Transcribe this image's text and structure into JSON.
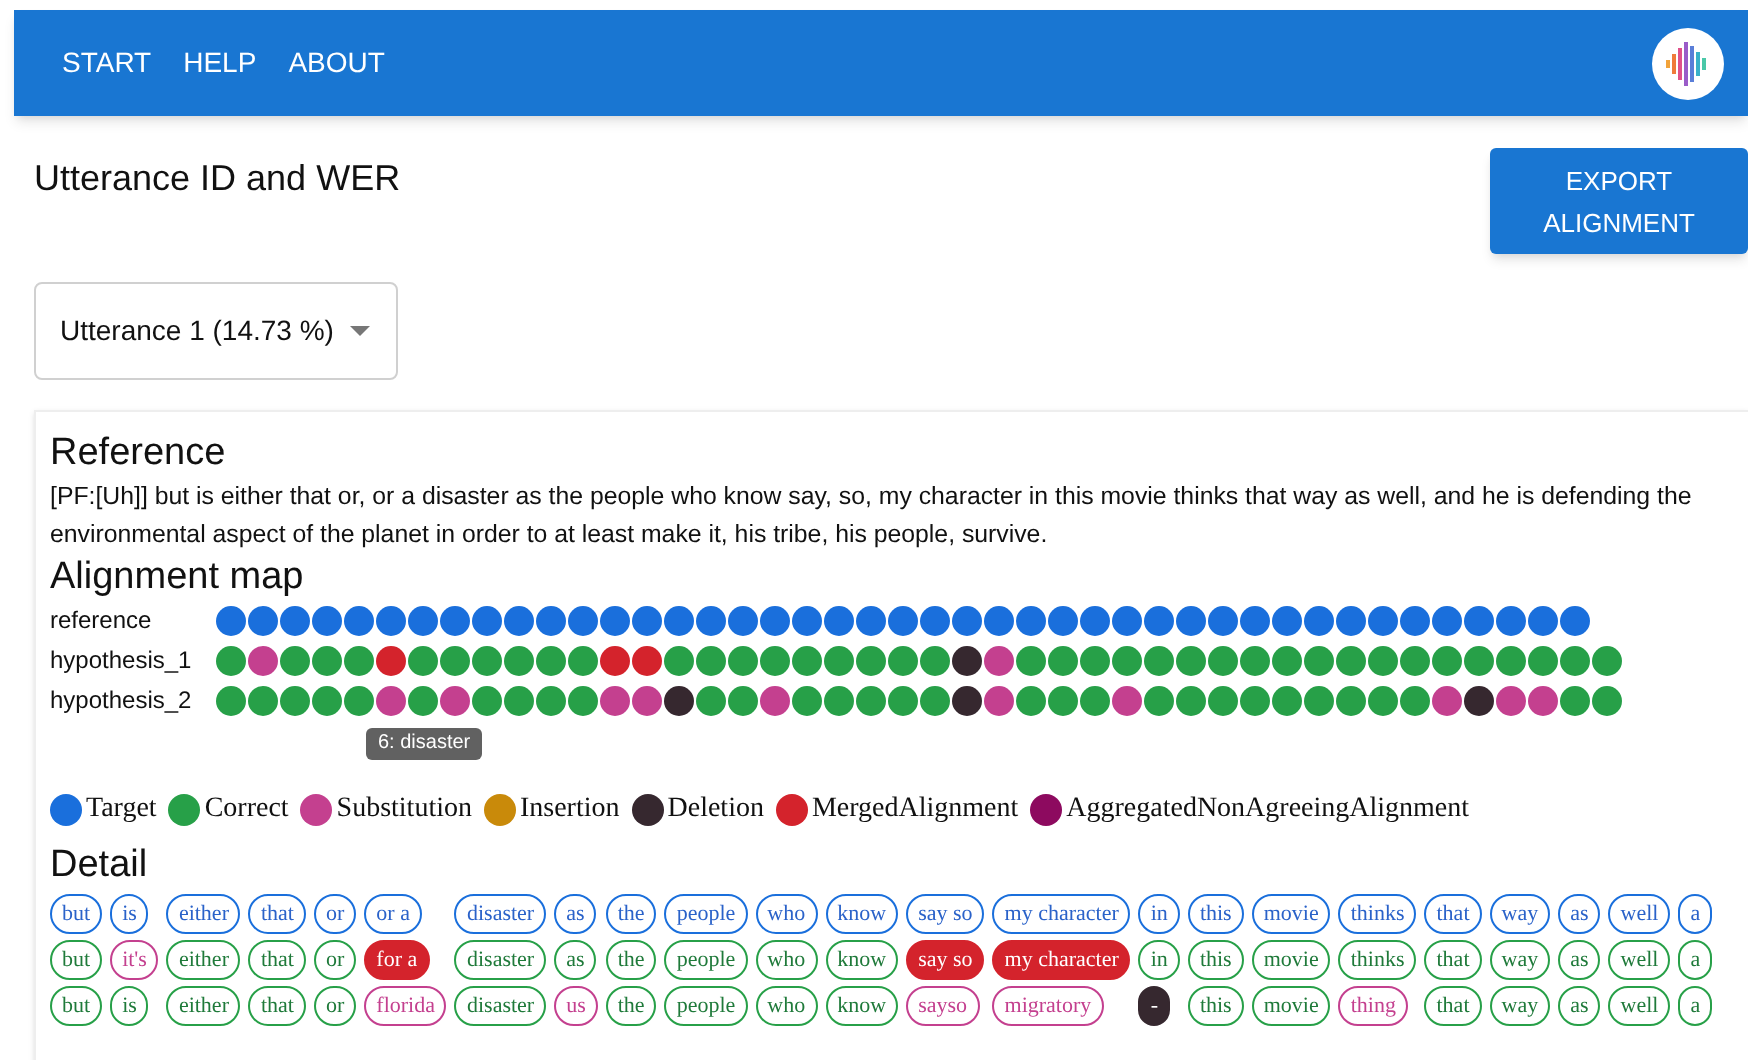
{
  "nav": {
    "items": [
      "START",
      "HELP",
      "ABOUT"
    ]
  },
  "heading": "Utterance ID and WER",
  "export_button": "EXPORT ALIGNMENT",
  "utterance_select": {
    "value": "Utterance 1 (14.73 %)"
  },
  "reference": {
    "title": "Reference",
    "text": "[PF:[Uh]] but is either that or, or a disaster as the people who know say, so, my character in this movie thinks that way as well, and he is defending the environmental aspect of the planet in order to at least make it, his tribe, his people, survive."
  },
  "alignment_map": {
    "title": "Alignment map",
    "rows": [
      {
        "label": "reference",
        "dots": [
          {
            "kind": "target"
          },
          {
            "kind": "target"
          },
          {
            "kind": "target"
          },
          {
            "kind": "target"
          },
          {
            "kind": "target"
          },
          {
            "kind": "target"
          },
          {
            "kind": "target"
          },
          {
            "kind": "target"
          },
          {
            "kind": "target"
          },
          {
            "kind": "target"
          },
          {
            "kind": "target"
          },
          {
            "kind": "target"
          },
          {
            "kind": "target"
          },
          {
            "kind": "target"
          },
          {
            "kind": "target"
          },
          {
            "kind": "target"
          },
          {
            "kind": "target"
          },
          {
            "kind": "target"
          },
          {
            "kind": "target"
          },
          {
            "kind": "target"
          },
          {
            "kind": "target"
          },
          {
            "kind": "target"
          },
          {
            "kind": "target"
          },
          {
            "kind": "target"
          },
          {
            "kind": "target"
          },
          {
            "kind": "target"
          },
          {
            "kind": "target"
          },
          {
            "kind": "target"
          },
          {
            "kind": "target"
          },
          {
            "kind": "target"
          },
          {
            "kind": "target"
          },
          {
            "kind": "target"
          },
          {
            "kind": "target"
          },
          {
            "kind": "target"
          },
          {
            "kind": "target"
          },
          {
            "kind": "target"
          },
          {
            "kind": "target"
          },
          {
            "kind": "target"
          },
          {
            "kind": "target"
          },
          {
            "kind": "target"
          },
          {
            "kind": "target"
          },
          {
            "kind": "target"
          },
          {
            "kind": "target"
          }
        ]
      },
      {
        "label": "hypothesis_1",
        "dots": [
          {
            "kind": "correct"
          },
          {
            "kind": "substitution"
          },
          {
            "kind": "correct"
          },
          {
            "kind": "correct"
          },
          {
            "kind": "correct"
          },
          {
            "kind": "merged"
          },
          {
            "kind": "correct"
          },
          {
            "kind": "correct"
          },
          {
            "kind": "correct"
          },
          {
            "kind": "correct"
          },
          {
            "kind": "correct"
          },
          {
            "kind": "correct"
          },
          {
            "kind": "merged"
          },
          {
            "kind": "merged"
          },
          {
            "kind": "correct"
          },
          {
            "kind": "correct"
          },
          {
            "kind": "correct"
          },
          {
            "kind": "correct"
          },
          {
            "kind": "correct"
          },
          {
            "kind": "correct"
          },
          {
            "kind": "correct"
          },
          {
            "kind": "correct"
          },
          {
            "kind": "correct"
          },
          {
            "kind": "deletion"
          },
          {
            "kind": "substitution"
          },
          {
            "kind": "correct"
          },
          {
            "kind": "correct"
          },
          {
            "kind": "correct"
          },
          {
            "kind": "correct"
          },
          {
            "kind": "correct"
          },
          {
            "kind": "correct"
          },
          {
            "kind": "correct"
          },
          {
            "kind": "correct"
          },
          {
            "kind": "correct"
          },
          {
            "kind": "correct"
          },
          {
            "kind": "correct"
          },
          {
            "kind": "correct"
          },
          {
            "kind": "correct"
          },
          {
            "kind": "correct"
          },
          {
            "kind": "correct"
          },
          {
            "kind": "correct"
          },
          {
            "kind": "correct"
          },
          {
            "kind": "correct"
          },
          {
            "kind": "correct"
          }
        ]
      },
      {
        "label": "hypothesis_2",
        "dots": [
          {
            "kind": "correct"
          },
          {
            "kind": "correct"
          },
          {
            "kind": "correct"
          },
          {
            "kind": "correct"
          },
          {
            "kind": "correct"
          },
          {
            "kind": "substitution"
          },
          {
            "kind": "correct",
            "tooltip": "6: disaster"
          },
          {
            "kind": "substitution"
          },
          {
            "kind": "correct"
          },
          {
            "kind": "correct"
          },
          {
            "kind": "correct"
          },
          {
            "kind": "correct"
          },
          {
            "kind": "substitution"
          },
          {
            "kind": "substitution"
          },
          {
            "kind": "deletion"
          },
          {
            "kind": "correct"
          },
          {
            "kind": "correct"
          },
          {
            "kind": "substitution"
          },
          {
            "kind": "correct"
          },
          {
            "kind": "correct"
          },
          {
            "kind": "correct"
          },
          {
            "kind": "correct"
          },
          {
            "kind": "correct"
          },
          {
            "kind": "deletion"
          },
          {
            "kind": "substitution"
          },
          {
            "kind": "correct"
          },
          {
            "kind": "correct"
          },
          {
            "kind": "correct"
          },
          {
            "kind": "substitution"
          },
          {
            "kind": "correct"
          },
          {
            "kind": "correct"
          },
          {
            "kind": "correct"
          },
          {
            "kind": "correct"
          },
          {
            "kind": "correct"
          },
          {
            "kind": "correct"
          },
          {
            "kind": "correct"
          },
          {
            "kind": "correct"
          },
          {
            "kind": "correct"
          },
          {
            "kind": "substitution"
          },
          {
            "kind": "deletion"
          },
          {
            "kind": "substitution"
          },
          {
            "kind": "substitution"
          },
          {
            "kind": "correct"
          },
          {
            "kind": "correct"
          }
        ]
      }
    ]
  },
  "legend": [
    {
      "label": "Target",
      "color": "#1a6fdc"
    },
    {
      "label": "Correct",
      "color": "#27a048"
    },
    {
      "label": "Substitution",
      "color": "#c4408f"
    },
    {
      "label": "Insertion",
      "color": "#c98a0a"
    },
    {
      "label": "Deletion",
      "color": "#36282f"
    },
    {
      "label": "MergedAlignment",
      "color": "#d4232c"
    },
    {
      "label": "AggregatedNonAgreeingAlignment",
      "color": "#8d0a5f"
    }
  ],
  "detail": {
    "title": "Detail",
    "columns": [
      [
        {
          "text": "but",
          "kind": "target"
        },
        {
          "text": "but",
          "kind": "correct"
        },
        {
          "text": "but",
          "kind": "correct"
        }
      ],
      [
        {
          "text": "is",
          "kind": "target"
        },
        {
          "text": "it's",
          "kind": "substitution"
        },
        {
          "text": "is",
          "kind": "correct"
        }
      ],
      [
        {
          "text": "either",
          "kind": "target"
        },
        {
          "text": "either",
          "kind": "correct"
        },
        {
          "text": "either",
          "kind": "correct"
        }
      ],
      [
        {
          "text": "that",
          "kind": "target"
        },
        {
          "text": "that",
          "kind": "correct"
        },
        {
          "text": "that",
          "kind": "correct"
        }
      ],
      [
        {
          "text": "or",
          "kind": "target"
        },
        {
          "text": "or",
          "kind": "correct"
        },
        {
          "text": "or",
          "kind": "correct"
        }
      ],
      [
        {
          "text": "or a",
          "kind": "target"
        },
        {
          "text": "for a",
          "kind": "merged"
        },
        {
          "text": "florida",
          "kind": "substitution"
        }
      ],
      [
        {
          "text": "disaster",
          "kind": "target"
        },
        {
          "text": "disaster",
          "kind": "correct"
        },
        {
          "text": "disaster",
          "kind": "correct"
        }
      ],
      [
        {
          "text": "as",
          "kind": "target"
        },
        {
          "text": "as",
          "kind": "correct"
        },
        {
          "text": "us",
          "kind": "substitution"
        }
      ],
      [
        {
          "text": "the",
          "kind": "target"
        },
        {
          "text": "the",
          "kind": "correct"
        },
        {
          "text": "the",
          "kind": "correct"
        }
      ],
      [
        {
          "text": "people",
          "kind": "target"
        },
        {
          "text": "people",
          "kind": "correct"
        },
        {
          "text": "people",
          "kind": "correct"
        }
      ],
      [
        {
          "text": "who",
          "kind": "target"
        },
        {
          "text": "who",
          "kind": "correct"
        },
        {
          "text": "who",
          "kind": "correct"
        }
      ],
      [
        {
          "text": "know",
          "kind": "target"
        },
        {
          "text": "know",
          "kind": "correct"
        },
        {
          "text": "know",
          "kind": "correct"
        }
      ],
      [
        {
          "text": "say so",
          "kind": "target"
        },
        {
          "text": "say so",
          "kind": "merged"
        },
        {
          "text": "sayso",
          "kind": "substitution"
        }
      ],
      [
        {
          "text": "my character",
          "kind": "target"
        },
        {
          "text": "my character",
          "kind": "merged"
        },
        {
          "text": "migratory",
          "kind": "substitution"
        }
      ],
      [
        {
          "text": "in",
          "kind": "target"
        },
        {
          "text": "in",
          "kind": "correct"
        },
        {
          "text": "-",
          "kind": "deletion"
        }
      ],
      [
        {
          "text": "this",
          "kind": "target"
        },
        {
          "text": "this",
          "kind": "correct"
        },
        {
          "text": "this",
          "kind": "correct"
        }
      ],
      [
        {
          "text": "movie",
          "kind": "target"
        },
        {
          "text": "movie",
          "kind": "correct"
        },
        {
          "text": "movie",
          "kind": "correct"
        }
      ],
      [
        {
          "text": "thinks",
          "kind": "target"
        },
        {
          "text": "thinks",
          "kind": "correct"
        },
        {
          "text": "thing",
          "kind": "substitution"
        }
      ],
      [
        {
          "text": "that",
          "kind": "target"
        },
        {
          "text": "that",
          "kind": "correct"
        },
        {
          "text": "that",
          "kind": "correct"
        }
      ],
      [
        {
          "text": "way",
          "kind": "target"
        },
        {
          "text": "way",
          "kind": "correct"
        },
        {
          "text": "way",
          "kind": "correct"
        }
      ],
      [
        {
          "text": "as",
          "kind": "target"
        },
        {
          "text": "as",
          "kind": "correct"
        },
        {
          "text": "as",
          "kind": "correct"
        }
      ],
      [
        {
          "text": "well",
          "kind": "target"
        },
        {
          "text": "well",
          "kind": "correct"
        },
        {
          "text": "well",
          "kind": "correct"
        }
      ],
      [
        {
          "text": "a",
          "kind": "target"
        },
        {
          "text": "a",
          "kind": "correct"
        },
        {
          "text": "a",
          "kind": "correct"
        }
      ]
    ]
  }
}
